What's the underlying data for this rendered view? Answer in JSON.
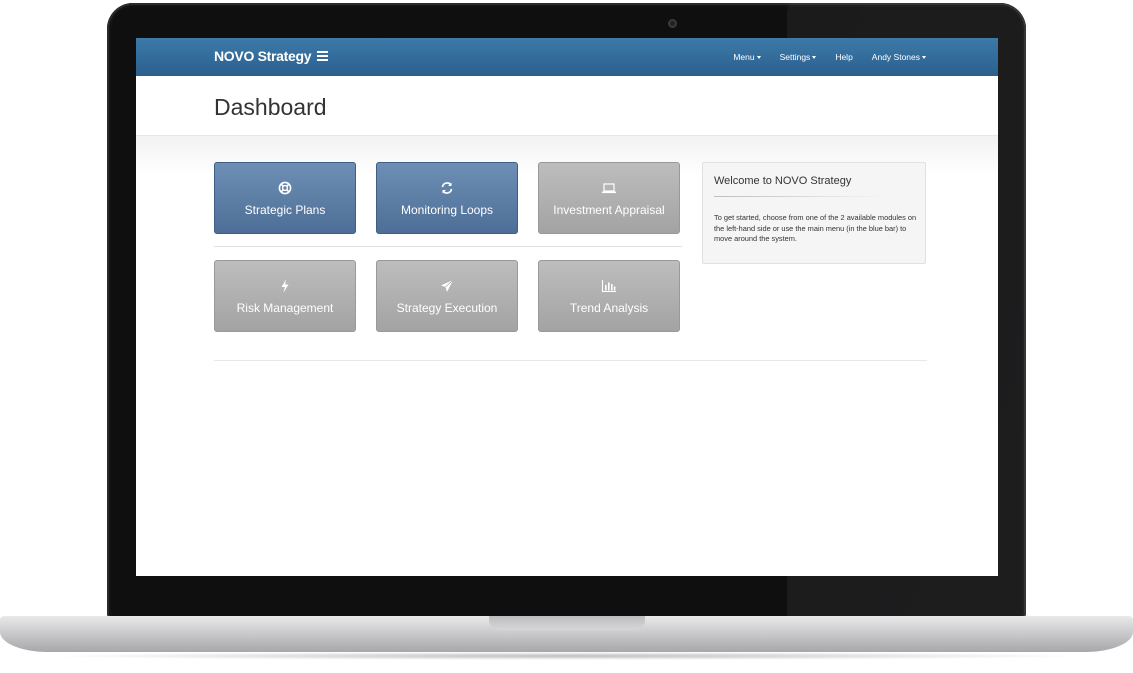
{
  "app": {
    "brand": "NOVO Strategy"
  },
  "navbar": {
    "items": [
      {
        "label": "Menu",
        "dropdown": true
      },
      {
        "label": "Settings",
        "dropdown": true
      },
      {
        "label": "Help",
        "dropdown": false
      },
      {
        "label": "Andy Stones",
        "dropdown": true
      }
    ]
  },
  "page": {
    "title": "Dashboard"
  },
  "modules": [
    {
      "label": "Strategic Plans",
      "icon": "life-ring-icon",
      "state": "active"
    },
    {
      "label": "Monitoring Loops",
      "icon": "refresh-icon",
      "state": "active"
    },
    {
      "label": "Investment Appraisal",
      "icon": "laptop-icon",
      "state": "inactive"
    },
    {
      "label": "Risk Management",
      "icon": "bolt-icon",
      "state": "inactive"
    },
    {
      "label": "Strategy Execution",
      "icon": "paper-plane-icon",
      "state": "inactive"
    },
    {
      "label": "Trend Analysis",
      "icon": "bar-chart-icon",
      "state": "inactive"
    }
  ],
  "welcome": {
    "title": "Welcome to NOVO Strategy",
    "text": "To get started, choose from one of the 2 available modules on the left-hand side or use the main menu (in the blue bar) to move around the system."
  },
  "colors": {
    "navbar": "#2f6a98",
    "active_tile": "#5a7ba2",
    "inactive_tile": "#acacac"
  }
}
